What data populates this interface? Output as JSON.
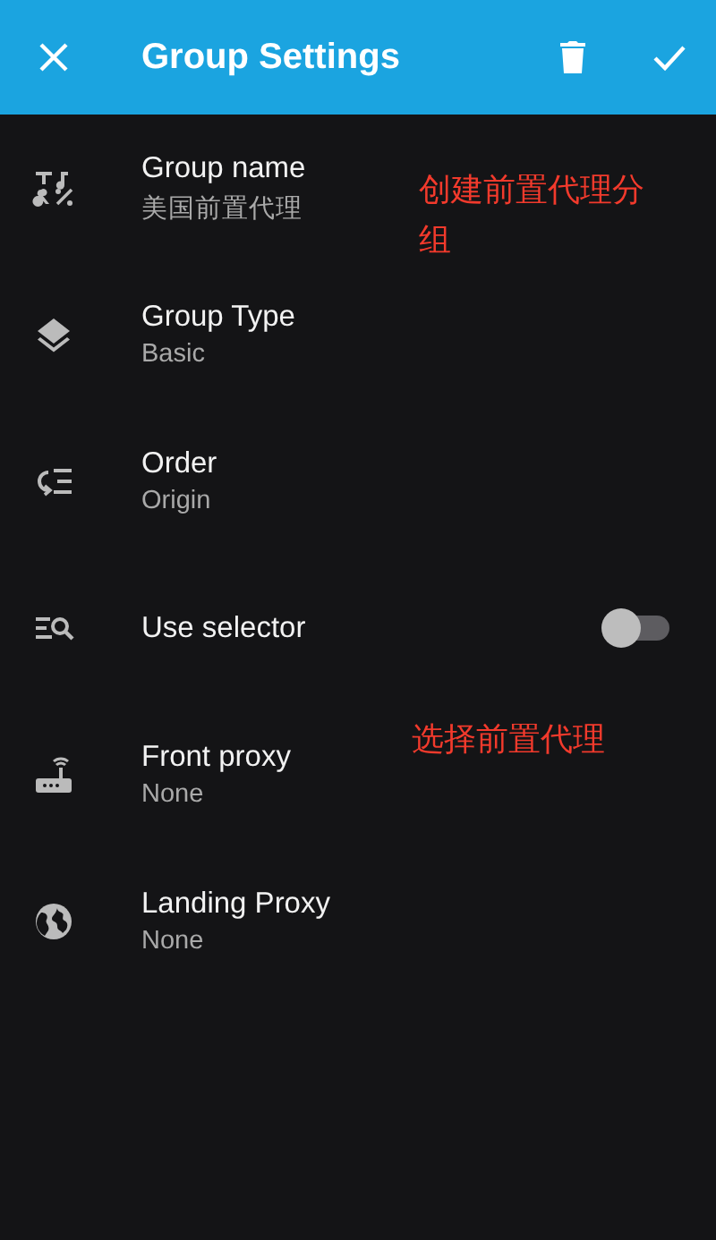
{
  "app_bar": {
    "title": "Group Settings"
  },
  "settings": [
    {
      "kind": "text",
      "title": "Group name",
      "value": "美国前置代理",
      "note": "创建前置代理分组"
    },
    {
      "kind": "text",
      "title": "Group Type",
      "value": "Basic"
    },
    {
      "kind": "text",
      "title": "Order",
      "value": "Origin"
    },
    {
      "kind": "switch",
      "title": "Use selector",
      "on": false
    },
    {
      "kind": "text",
      "title": "Front proxy",
      "value": "None",
      "note": "选择前置代理"
    },
    {
      "kind": "text",
      "title": "Landing Proxy",
      "value": "None"
    }
  ]
}
